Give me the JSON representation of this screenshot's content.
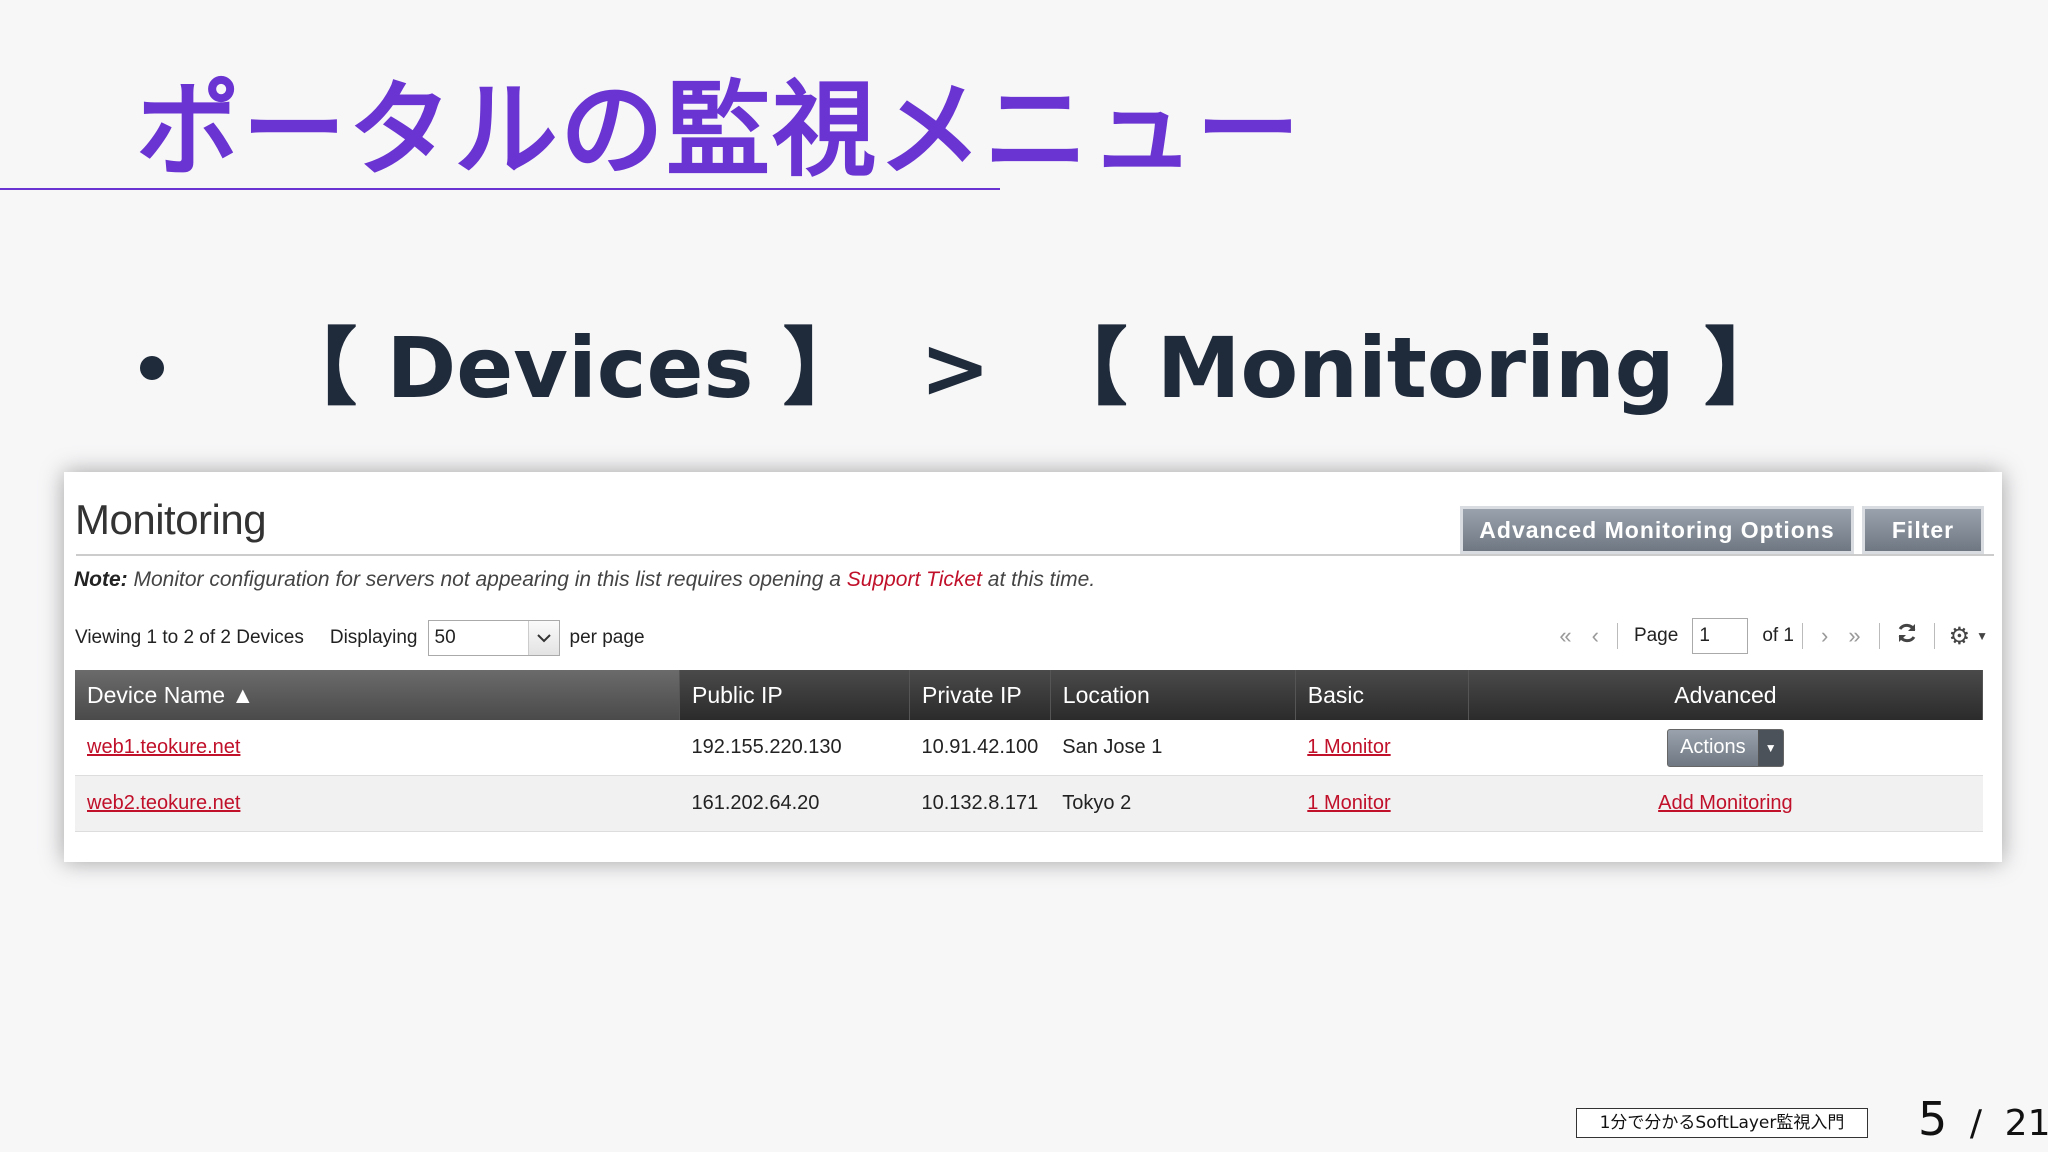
{
  "slide": {
    "title": "ポータルの監視メニュー",
    "bullet": {
      "devices": "【 Devices 】",
      "sep": ">",
      "monitoring": "【 Monitoring 】"
    },
    "footer": "1分で分かるSoftLayer監視入門",
    "page_current": "5",
    "page_sep": "/",
    "page_total": "21"
  },
  "panel": {
    "title": "Monitoring",
    "buttons": {
      "advanced": "Advanced Monitoring Options",
      "filter": "Filter"
    },
    "note": {
      "label": "Note:",
      "before": " Monitor configuration for servers not appearing in this list requires opening a ",
      "link": "Support Ticket",
      "after": " at this time."
    },
    "toolbar": {
      "viewing": "Viewing 1 to 2 of 2 Devices",
      "displaying": "Displaying",
      "per_page_value": "50",
      "per_page": "per page",
      "page_label": "Page",
      "page_value": "1",
      "of": "of 1"
    },
    "table": {
      "columns": [
        "Device Name ▲",
        "Public IP",
        "Private IP",
        "Location",
        "Basic",
        "Advanced"
      ],
      "rows": [
        {
          "device": "web1.teokure.net",
          "public_ip": "192.155.220.130",
          "private_ip": "10.91.42.100",
          "location": "San Jose 1",
          "basic": "1 Monitor",
          "advanced": "Actions"
        },
        {
          "device": "web2.teokure.net",
          "public_ip": "161.202.64.20",
          "private_ip": "10.132.8.171",
          "location": "Tokyo 2",
          "basic": "1 Monitor",
          "advanced": "Add Monitoring"
        }
      ]
    }
  }
}
